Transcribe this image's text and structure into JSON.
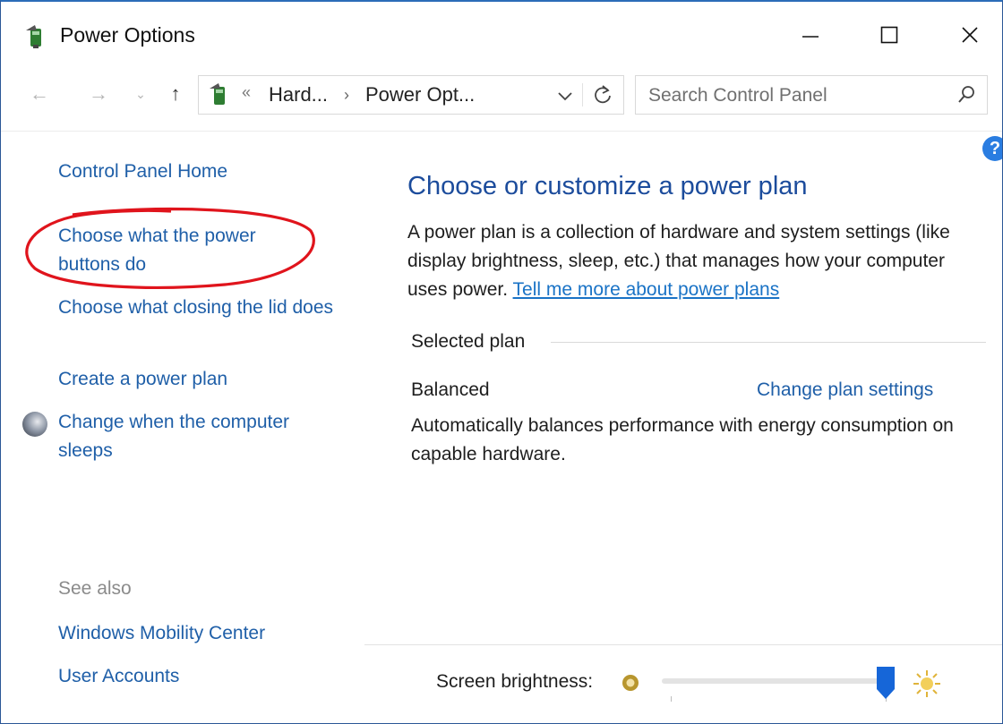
{
  "window": {
    "title": "Power Options"
  },
  "nav": {
    "breadcrumb_sep": "«",
    "crumbs": [
      "Hard...",
      "Power Opt..."
    ],
    "crumb_arrow": "›",
    "search_placeholder": "Search Control Panel"
  },
  "left_pane": {
    "home": "Control Panel Home",
    "links": [
      "Choose what the power buttons do",
      "Choose what closing the lid does",
      "Create a power plan",
      "Change when the computer sleeps"
    ],
    "see_also_label": "See also",
    "see_also": [
      "Windows Mobility Center",
      "User Accounts"
    ]
  },
  "main": {
    "heading": "Choose or customize a power plan",
    "description": "A power plan is a collection of hardware and system settings (like display brightness, sleep, etc.) that manages how your computer uses power.",
    "description_link": "Tell me more about power plans",
    "selected_plan_label": "Selected plan",
    "plan": {
      "name": "Balanced",
      "change_link": "Change plan settings",
      "description": "Automatically balances performance with energy consumption on capable hardware."
    }
  },
  "brightness": {
    "label": "Screen brightness:",
    "level": 0.96
  },
  "annotation": {
    "color": "#e0141c"
  },
  "colors": {
    "link": "#1f5fa8",
    "heading": "#1c4c9c",
    "accent": "#2b6cb8",
    "slider_thumb": "#1666d8"
  }
}
